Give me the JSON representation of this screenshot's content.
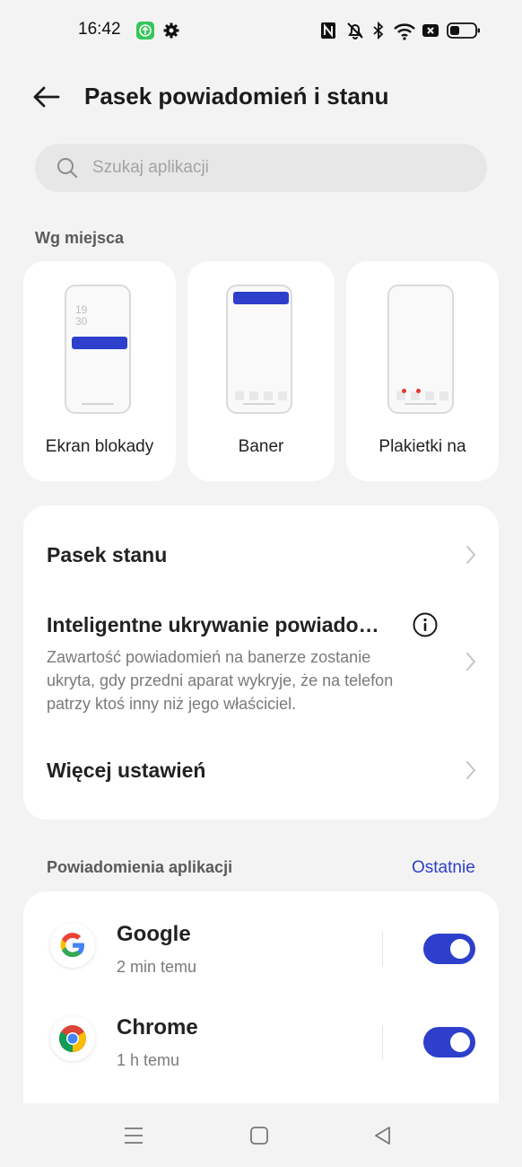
{
  "status_bar": {
    "time": "16:42",
    "left_icons": [
      "app-update-icon",
      "gear-icon"
    ],
    "right_icons": [
      "nfc-icon",
      "mute-icon",
      "bluetooth-icon",
      "wifi-icon",
      "no-sim-icon",
      "battery-icon"
    ]
  },
  "header": {
    "title": "Pasek powiadomień i stanu",
    "back_icon": "back-arrow-icon"
  },
  "search": {
    "placeholder": "Szukaj aplikacji"
  },
  "placement": {
    "section_label": "Wg miejsca",
    "cards": [
      {
        "label": "Ekran blokady",
        "preview_time": [
          "19",
          "30"
        ]
      },
      {
        "label": "Baner"
      },
      {
        "label": "Plakietki na"
      }
    ]
  },
  "settings": {
    "status_bar": {
      "title": "Pasek stanu"
    },
    "smart_hide": {
      "title": "Inteligentne ukrywanie powiado…",
      "description": "Zawartość powiadomień na banerze zostanie ukryta, gdy przedni aparat wykryje, że na telefon patrzy ktoś inny niż jego właściciel."
    },
    "more": {
      "title": "Więcej ustawień"
    }
  },
  "app_notifications": {
    "label": "Powiadomienia aplikacji",
    "sort_link": "Ostatnie",
    "apps": [
      {
        "name": "Google",
        "time": "2 min temu",
        "enabled": true
      },
      {
        "name": "Chrome",
        "time": "1 h temu",
        "enabled": true
      }
    ]
  },
  "colors": {
    "accent": "#2d3fcb",
    "background": "#f3f3f3",
    "card": "#ffffff",
    "badge_red": "#e53935"
  },
  "nav_bar": {
    "icons": [
      "menu-icon",
      "home-icon",
      "back-icon"
    ]
  }
}
